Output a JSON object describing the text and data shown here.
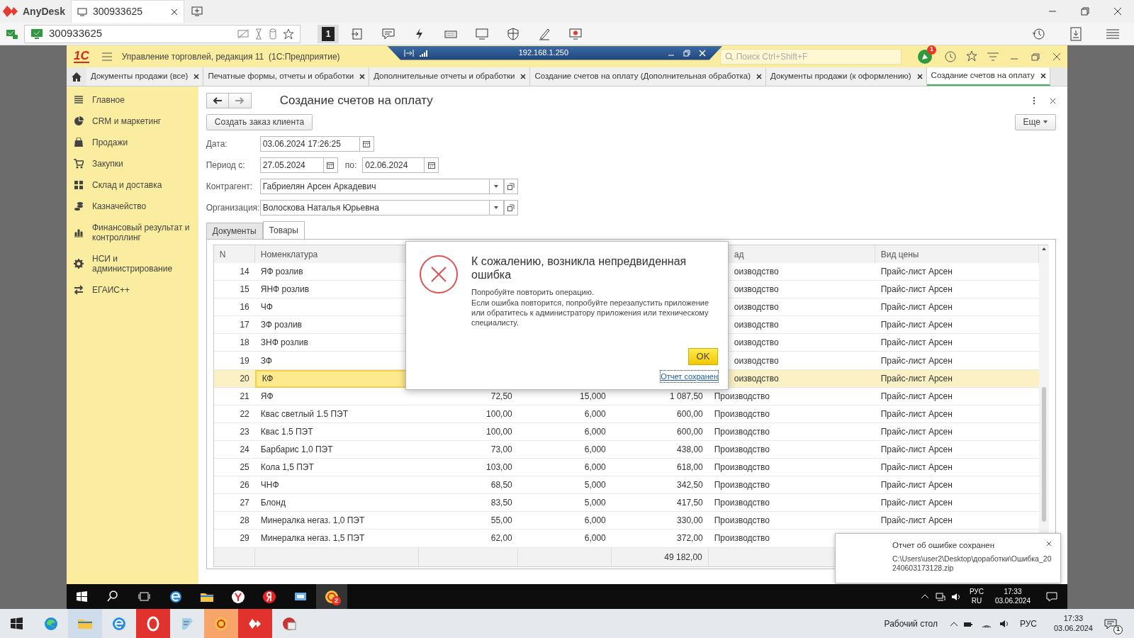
{
  "anydesk": {
    "app_name": "AnyDesk",
    "tabs": [
      {
        "label": "300933625",
        "selected": true
      }
    ],
    "address": "300933625",
    "monitor_number": "1"
  },
  "onec": {
    "logo": "1С",
    "title": "Управление торговлей, редакция 11  (1С:Предприятие)",
    "remote_bar": {
      "address": "192.168.1.250"
    },
    "search": {
      "placeholder": "Поиск Ctrl+Shift+F"
    },
    "notification_count": "1",
    "tabs": [
      {
        "label": "Документы продажи (все)",
        "selected": false
      },
      {
        "label": "Печатные формы, отчеты и обработки",
        "selected": false
      },
      {
        "label": "Дополнительные отчеты и обработки",
        "selected": false
      },
      {
        "label": "Создание счетов на оплату (Дополнительная обработка)",
        "selected": false
      },
      {
        "label": "Документы продажи (к оформлению)",
        "selected": false
      },
      {
        "label": "Создание счетов на оплату",
        "selected": true
      }
    ],
    "sidebar": {
      "items": [
        {
          "label": "Главное"
        },
        {
          "label": "CRM и маркетинг"
        },
        {
          "label": "Продажи"
        },
        {
          "label": "Закупки"
        },
        {
          "label": "Склад и доставка"
        },
        {
          "label": "Казначейство"
        },
        {
          "label": "Финансовый результат и контроллинг"
        },
        {
          "label": "НСИ и администрирование"
        },
        {
          "label": "ЕГАИС++"
        }
      ]
    },
    "form": {
      "title": "Создание счетов на оплату",
      "create_button": "Создать заказ клиента",
      "more_button": "Еще",
      "date": {
        "label": "Дата:",
        "value": "03.06.2024 17:26:25"
      },
      "period": {
        "label": "Период с:",
        "from": "27.05.2024",
        "to_label": "по:",
        "to": "02.06.2024"
      },
      "counterparty": {
        "label": "Контрагент:",
        "value": "Габриелян Арсен Аркадевич"
      },
      "organization": {
        "label": "Организация:",
        "value": "Волоскова Наталья Юрьевна"
      },
      "tabs": [
        {
          "label": "Документы",
          "selected": false
        },
        {
          "label": "Товары",
          "selected": true
        }
      ],
      "table": {
        "columns": [
          "N",
          "Номенклатура",
          null,
          null,
          null,
          "ад",
          "Вид цены"
        ],
        "rows": [
          {
            "cells": [
              "14",
              "ЯФ розлив",
              null,
              null,
              null,
              "оизводство",
              "Прайс-лист Арсен"
            ],
            "selected": false
          },
          {
            "cells": [
              "15",
              "ЯНФ розлив",
              null,
              null,
              null,
              "оизводство",
              "Прайс-лист Арсен"
            ],
            "selected": false
          },
          {
            "cells": [
              "16",
              "ЧФ",
              null,
              null,
              null,
              "оизводство",
              "Прайс-лист Арсен"
            ],
            "selected": false
          },
          {
            "cells": [
              "17",
              "ЗФ розлив",
              null,
              null,
              null,
              "оизводство",
              "Прайс-лист Арсен"
            ],
            "selected": false
          },
          {
            "cells": [
              "18",
              "ЗНФ розлив",
              null,
              null,
              null,
              "оизводство",
              "Прайс-лист Арсен"
            ],
            "selected": false
          },
          {
            "cells": [
              "19",
              "ЗФ",
              null,
              null,
              null,
              "оизводство",
              "Прайс-лист Арсен"
            ],
            "selected": false
          },
          {
            "cells": [
              "20",
              "КФ",
              null,
              null,
              null,
              "оизводство",
              "Прайс-лист Арсен"
            ],
            "selected": true
          },
          {
            "cells": [
              "21",
              "ЯФ",
              "72,50",
              "15,000",
              "1 087,50",
              "Производство",
              "Прайс-лист Арсен"
            ],
            "selected": false
          },
          {
            "cells": [
              "22",
              "Квас светлый 1.5 ПЭТ",
              "100,00",
              "6,000",
              "600,00",
              "Производство",
              "Прайс-лист Арсен"
            ],
            "selected": false
          },
          {
            "cells": [
              "23",
              "Квас 1.5 ПЭТ",
              "100,00",
              "6,000",
              "600,00",
              "Производство",
              "Прайс-лист Арсен"
            ],
            "selected": false
          },
          {
            "cells": [
              "24",
              "Барбарис 1,0 ПЭТ",
              "73,00",
              "6,000",
              "438,00",
              "Производство",
              "Прайс-лист Арсен"
            ],
            "selected": false
          },
          {
            "cells": [
              "25",
              "Кола 1,5 ПЭТ",
              "103,00",
              "6,000",
              "618,00",
              "Производство",
              "Прайс-лист Арсен"
            ],
            "selected": false
          },
          {
            "cells": [
              "26",
              "ЧНФ",
              "68,50",
              "5,000",
              "342,50",
              "Производство",
              "Прайс-лист Арсен"
            ],
            "selected": false
          },
          {
            "cells": [
              "27",
              "Блонд",
              "83,50",
              "5,000",
              "417,50",
              "Производство",
              "Прайс-лист Арсен"
            ],
            "selected": false
          },
          {
            "cells": [
              "28",
              "Минералка негаз. 1,0 ПЭТ",
              "55,00",
              "6,000",
              "330,00",
              "Производство",
              "Прайс-лист Арсен"
            ],
            "selected": false
          },
          {
            "cells": [
              "29",
              "Минералка негаз. 1,5 ПЭТ",
              "62,00",
              "6,000",
              "372,00",
              "Производство",
              null
            ],
            "selected": false
          }
        ],
        "totals": {
          "sum": "49 182,00"
        }
      }
    },
    "dialog": {
      "title": "К сожалению, возникла непредвиденная ошибка",
      "lines": [
        "Попробуйте повторить операцию.",
        "Если ошибка повторится, попробуйте перезапустить приложение или обратитесь к администратору приложения или техническому специалисту."
      ],
      "ok_button": "OK",
      "link": "Отчет сохранен"
    },
    "toast": {
      "title": "Отчет об ошибке сохранен",
      "path": "C:\\Users\\user2\\Desktop\\доработки\\Ошибка_20240603173128.zip"
    }
  },
  "remote_taskbar": {
    "app_badge": "2",
    "lang": "РУС",
    "lang_code": "RU",
    "time": "17:33",
    "date": "03.06.2024"
  },
  "taskbar": {
    "desktop_label": "Рабочий стол",
    "lang": "РУС",
    "time": "17:33",
    "date": "03.06.2024",
    "notification_count": "1"
  }
}
